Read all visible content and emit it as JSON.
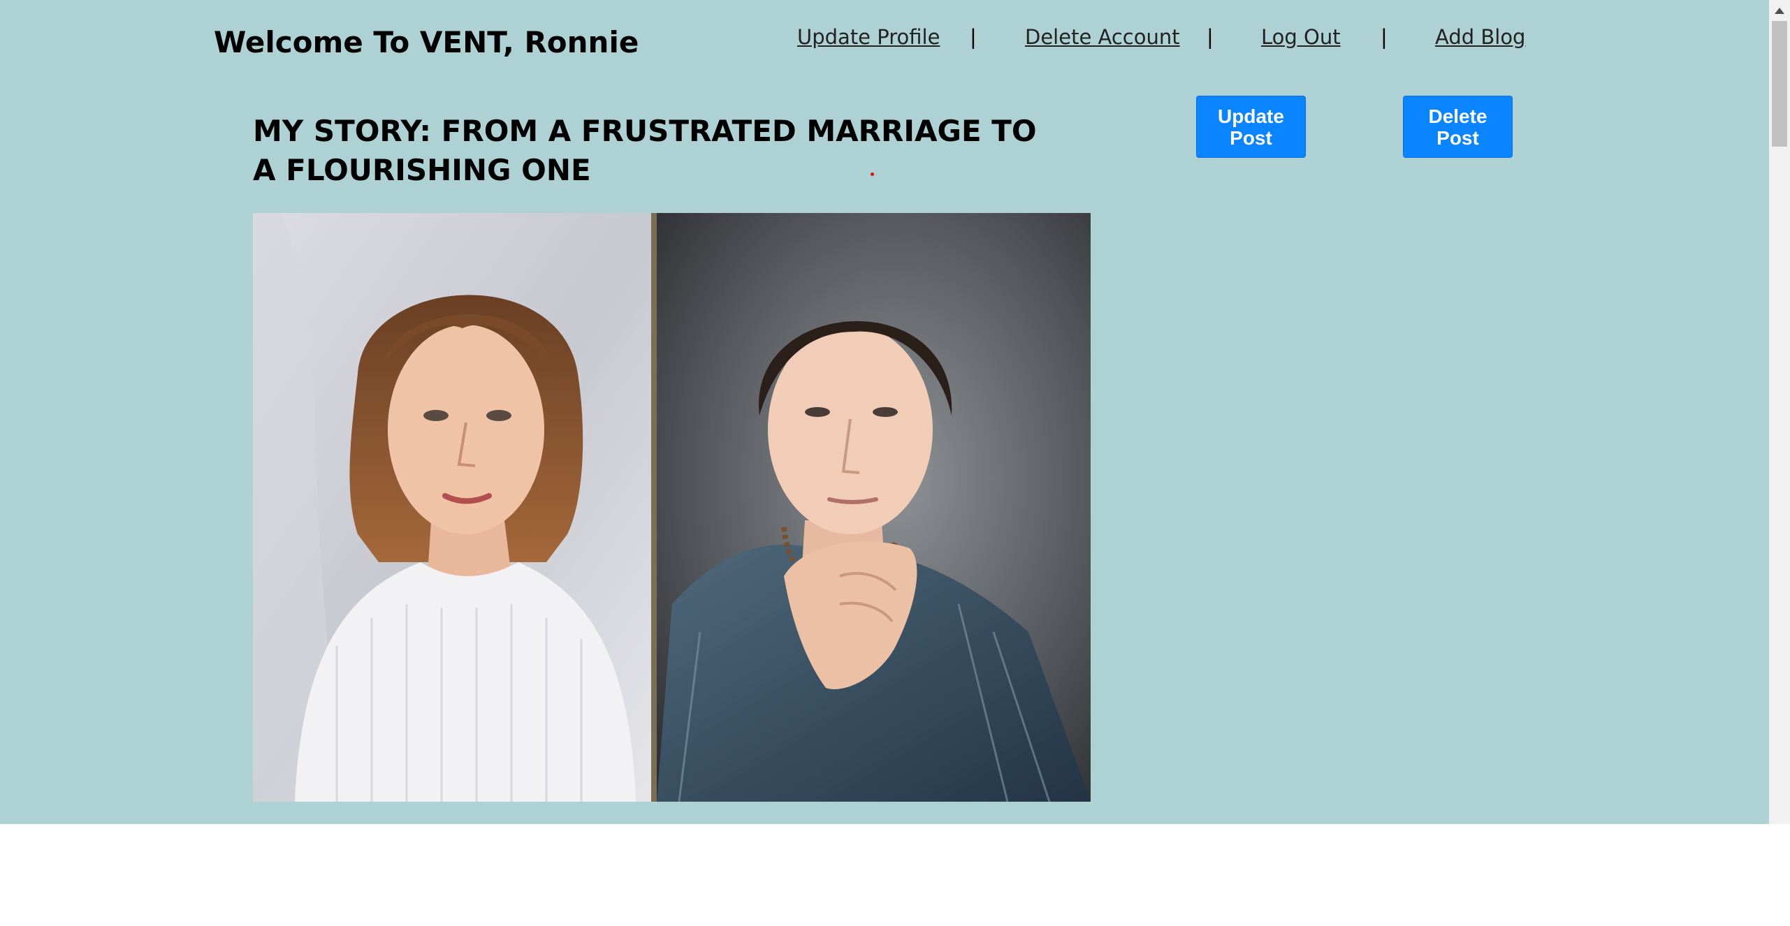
{
  "header": {
    "welcome": "Welcome To VENT, Ronnie",
    "nav": {
      "update_profile": "Update Profile",
      "delete_account": "Delete Account",
      "log_out": "Log Out",
      "add_blog": "Add Blog",
      "separator": "|"
    }
  },
  "post": {
    "title": "MY STORY: FROM A FRUSTRATED MARRIAGE TO A FLOURISHING ONE",
    "update_button": "Update Post",
    "delete_button": "Delete Post",
    "image_description": "portrait-pair-photo"
  },
  "colors": {
    "page_background": "#aed1d4",
    "button_blue": "#0a84ff"
  }
}
